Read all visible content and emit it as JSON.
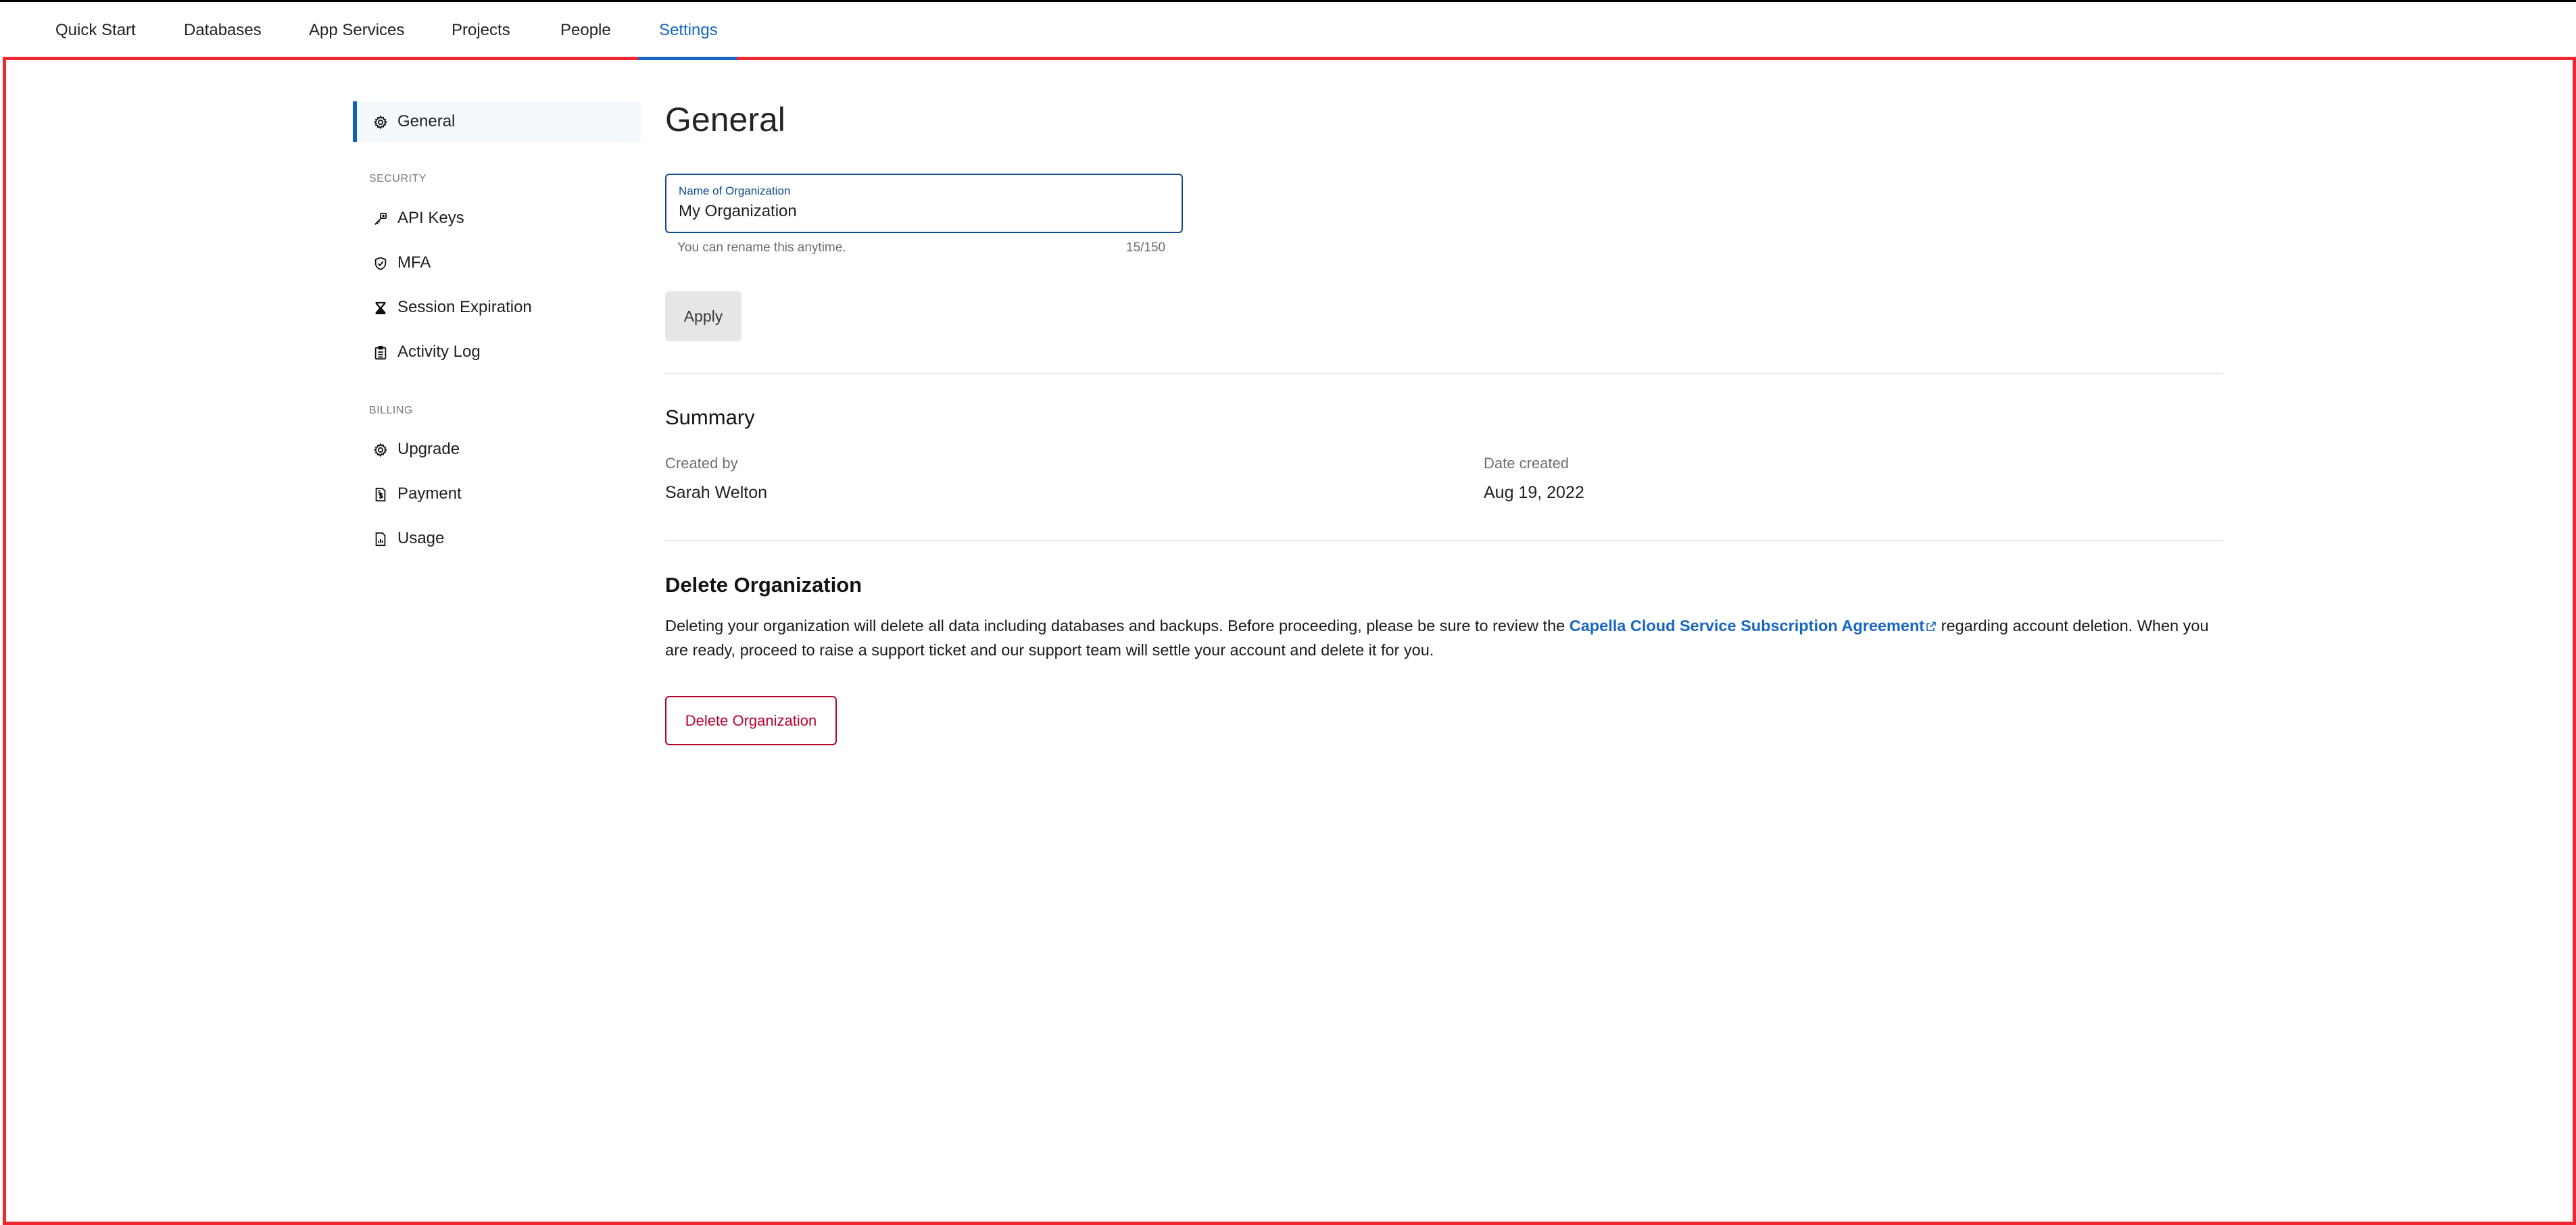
{
  "colors": {
    "accent": "#1766c0",
    "danger": "#b4042c",
    "frame": "#ee2730"
  },
  "topnav": {
    "items": [
      {
        "label": "Quick Start",
        "active": false
      },
      {
        "label": "Databases",
        "active": false
      },
      {
        "label": "App Services",
        "active": false
      },
      {
        "label": "Projects",
        "active": false
      },
      {
        "label": "People",
        "active": false
      },
      {
        "label": "Settings",
        "active": true
      }
    ]
  },
  "sidebar": {
    "general": {
      "label": "General",
      "icon": "gear-icon",
      "active": true
    },
    "security_heading": "SECURITY",
    "security_items": [
      {
        "label": "API Keys",
        "icon": "key-icon"
      },
      {
        "label": "MFA",
        "icon": "shield-check-icon"
      },
      {
        "label": "Session Expiration",
        "icon": "hourglass-icon"
      },
      {
        "label": "Activity Log",
        "icon": "clipboard-list-icon"
      }
    ],
    "billing_heading": "BILLING",
    "billing_items": [
      {
        "label": "Upgrade",
        "icon": "gear-icon"
      },
      {
        "label": "Payment",
        "icon": "invoice-dollar-icon"
      },
      {
        "label": "Usage",
        "icon": "file-chart-icon"
      }
    ]
  },
  "main": {
    "title": "General",
    "org_field": {
      "label": "Name of Organization",
      "value": "My Organization",
      "helper": "You can rename this anytime.",
      "counter": "15/150"
    },
    "apply_label": "Apply",
    "summary": {
      "title": "Summary",
      "created_by_label": "Created by",
      "created_by_value": "Sarah Welton",
      "date_created_label": "Date created",
      "date_created_value": "Aug 19, 2022"
    },
    "delete": {
      "title": "Delete Organization",
      "text_before": "Deleting your organization will delete all data including databases and backups. Before proceeding, please be sure to review the ",
      "link_text": "Capella Cloud Service Subscription Agreement",
      "text_after": " regarding account deletion. When you are ready, proceed to raise a support ticket and our support team will settle your account and delete it for you.",
      "button_label": "Delete Organization"
    }
  }
}
